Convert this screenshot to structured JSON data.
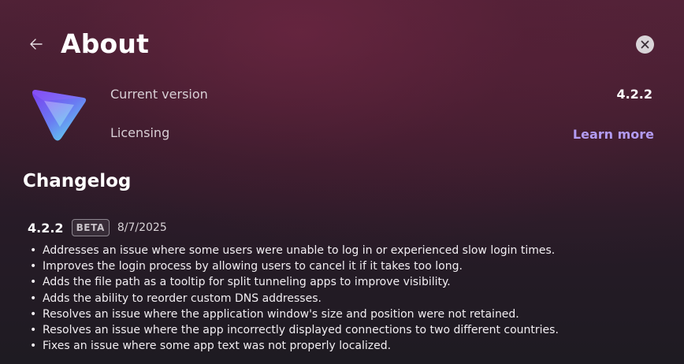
{
  "header": {
    "title": "About",
    "back_icon": "arrow-left-icon",
    "close_icon": "close-icon"
  },
  "app": {
    "logo_icon": "app-logo",
    "current_version_label": "Current version",
    "current_version_value": "4.2.2",
    "licensing_label": "Licensing",
    "learn_more_label": "Learn more"
  },
  "changelog": {
    "title": "Changelog",
    "releases": [
      {
        "version": "4.2.2",
        "badge": "BETA",
        "date": "8/7/2025",
        "bullet": "•",
        "changes": [
          "Addresses an issue where some users were unable to log in or experienced slow login times.",
          "Improves the login process by allowing users to cancel it if it takes too long.",
          "Adds the file path as a tooltip for split tunneling apps to improve visibility.",
          "Adds the ability to reorder custom DNS addresses.",
          "Resolves an issue where the application window's size and position were not retained.",
          "Resolves an issue where the app incorrectly displayed connections to two different countries.",
          "Fixes an issue where some app text was not properly localized."
        ]
      }
    ]
  },
  "colors": {
    "link": "#b39bf2",
    "background_top": "#4e2236",
    "background_bottom": "#1e1b22",
    "logo_gradient_start": "#7b3cf0",
    "logo_gradient_end": "#5fd9ef"
  }
}
